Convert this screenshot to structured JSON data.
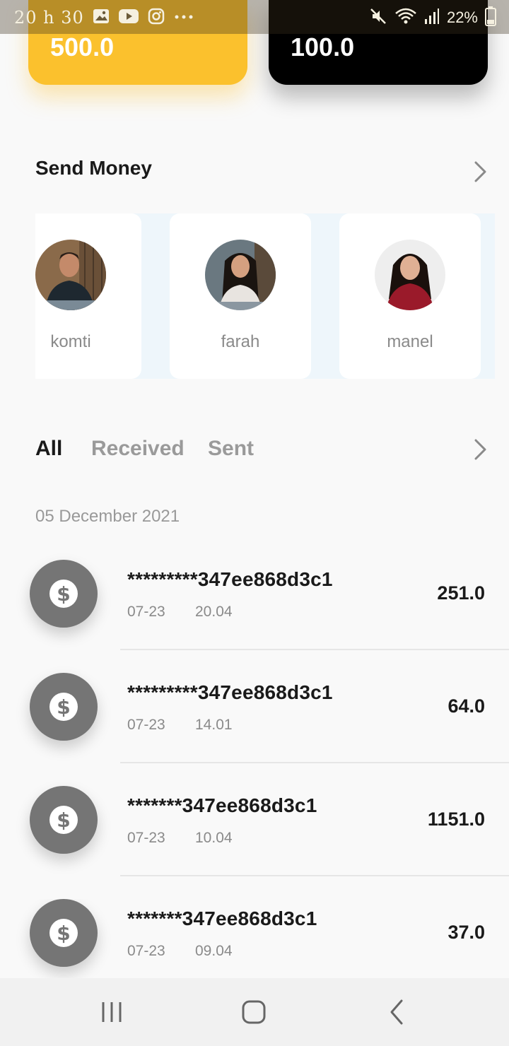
{
  "status_bar": {
    "time": "20 h 30",
    "battery": "22%",
    "left_icons": [
      "gallery-icon",
      "youtube-icon",
      "instagram-icon",
      "more-dots-icon"
    ],
    "right_icons": [
      "mute-icon",
      "wifi-icon",
      "signal-icon",
      "battery-icon"
    ]
  },
  "balances": [
    {
      "amount": "500.0",
      "color": "#fbc12d"
    },
    {
      "amount": "100.0",
      "color": "#000000"
    }
  ],
  "send_money": {
    "title": "Send Money",
    "contacts": [
      {
        "name": "komti"
      },
      {
        "name": "farah"
      },
      {
        "name": "manel"
      }
    ]
  },
  "tabs": [
    {
      "label": "All",
      "active": true
    },
    {
      "label": "Received",
      "active": false
    },
    {
      "label": "Sent",
      "active": false
    }
  ],
  "date_header": "05 December 2021",
  "transactions": [
    {
      "id": "*********347ee868d3c1",
      "date": "07-23",
      "time": "20.04",
      "amount": "251.0"
    },
    {
      "id": "*********347ee868d3c1",
      "date": "07-23",
      "time": "14.01",
      "amount": "64.0"
    },
    {
      "id": "*******347ee868d3c1",
      "date": "07-23",
      "time": "10.04",
      "amount": "1151.0"
    },
    {
      "id": "*******347ee868d3c1",
      "date": "07-23",
      "time": "09.04",
      "amount": "37.0"
    }
  ],
  "colors": {
    "accent_yellow": "#fbc12d",
    "coin_gray": "#757575",
    "muted_text": "#8a8a8a"
  }
}
